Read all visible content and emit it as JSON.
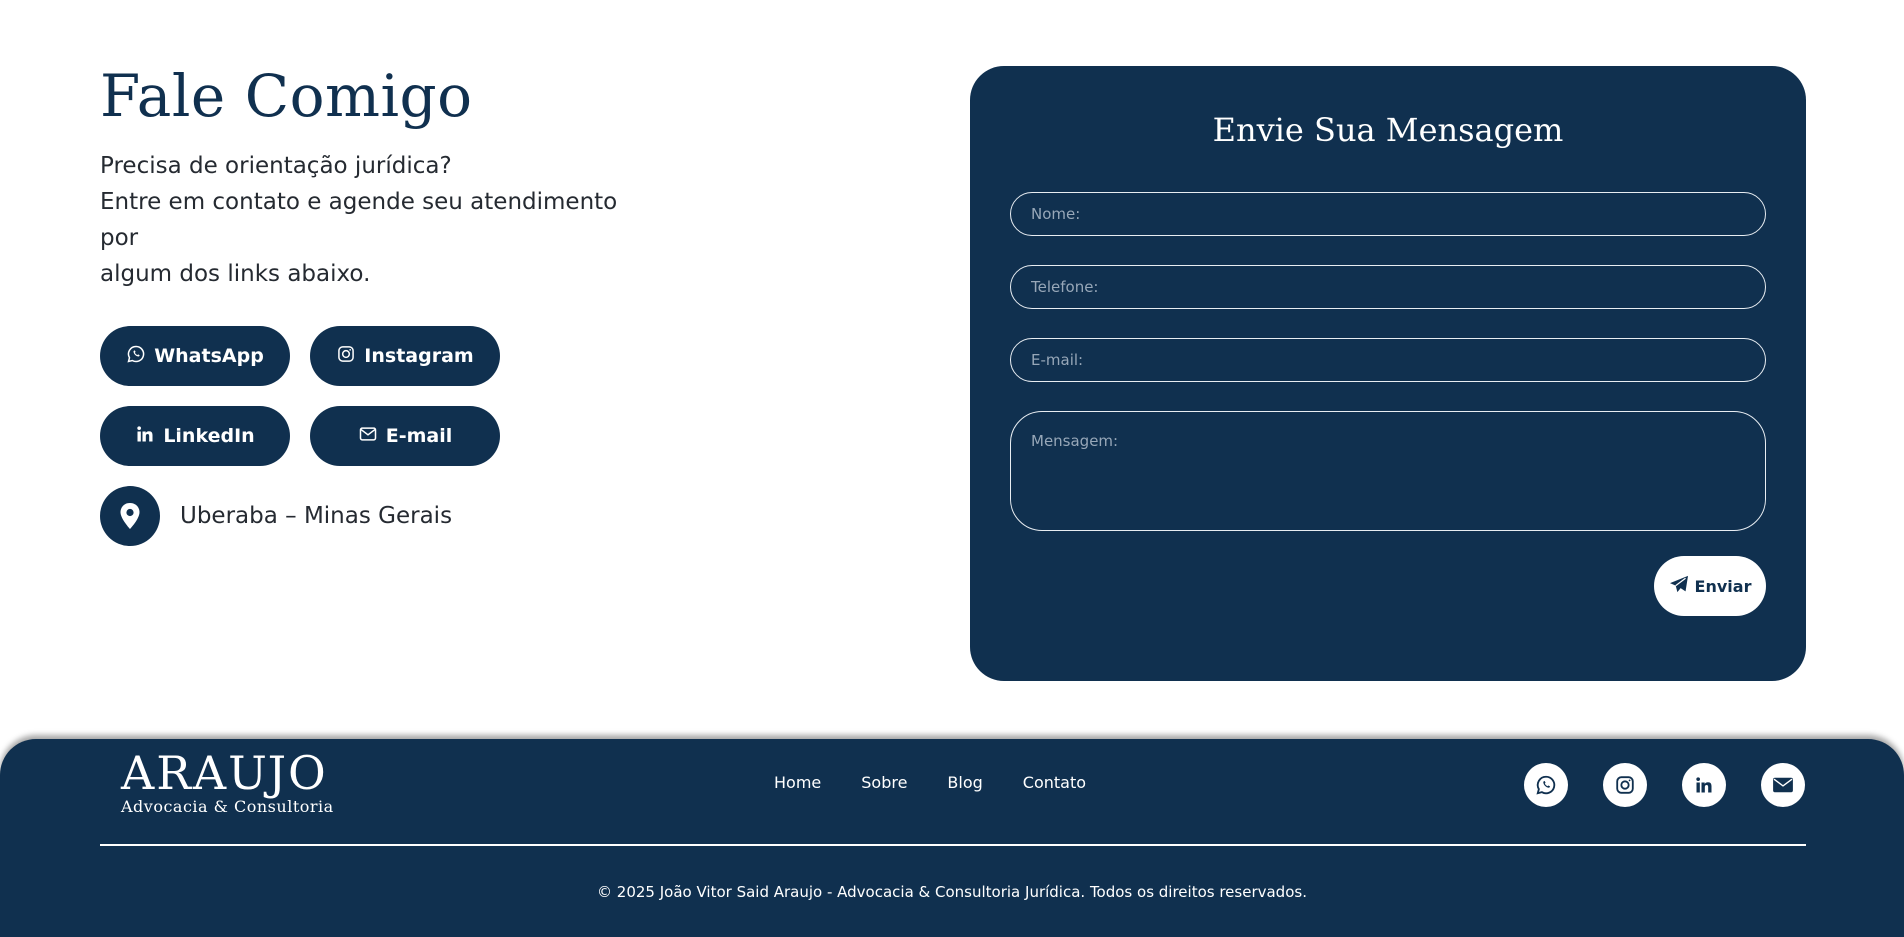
{
  "contact": {
    "title": "Fale Comigo",
    "intro_line1": "Precisa de orientação jurídica?",
    "intro_line2": "Entre em contato e agende seu atendimento por",
    "intro_line3": "algum dos links abaixo.",
    "buttons": {
      "whatsapp": "WhatsApp",
      "instagram": "Instagram",
      "linkedin": "LinkedIn",
      "email": "E-mail"
    },
    "location": "Uberaba – Minas Gerais"
  },
  "form": {
    "title": "Envie Sua Mensagem",
    "name_placeholder": "Nome:",
    "phone_placeholder": "Telefone:",
    "email_placeholder": "E-mail:",
    "message_placeholder": "Mensagem:",
    "submit_label": "Enviar"
  },
  "footer": {
    "logo_main": "ARAUJO",
    "logo_sub": "Advocacia & Consultoria",
    "nav": [
      "Home",
      "Sobre",
      "Blog",
      "Contato"
    ],
    "socials": [
      "whatsapp-icon",
      "instagram-icon",
      "linkedin-icon",
      "envelope-icon"
    ],
    "copyright": "© 2025 João Vitor Said Araujo - Advocacia & Consultoria Jurídica. Todos os direitos reservados."
  },
  "colors": {
    "primary": "#10304f",
    "text": "#252a31",
    "white": "#ffffff"
  }
}
